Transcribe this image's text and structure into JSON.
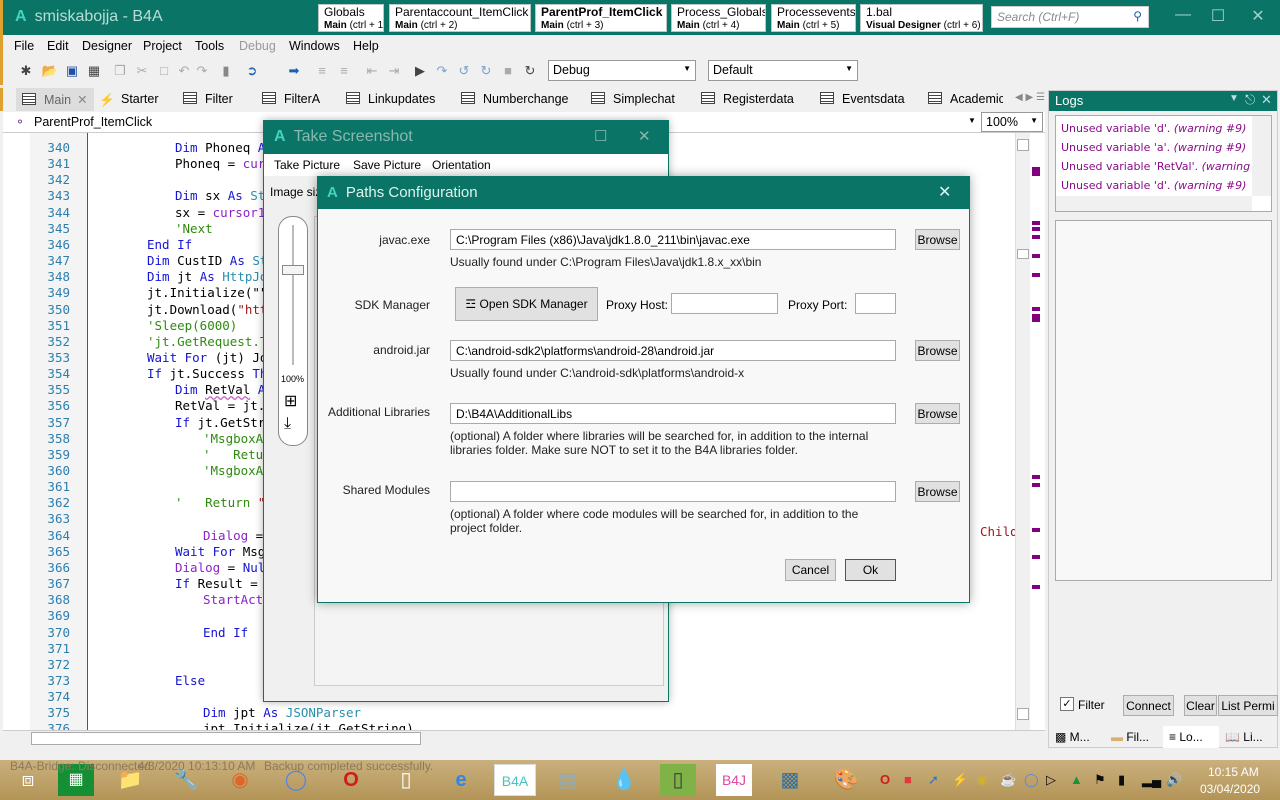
{
  "app": {
    "title": "smiskabojja - B4A",
    "logo": "A"
  },
  "quick_tabs": [
    {
      "name": "Globals",
      "module": "Main",
      "shortcut": "(ctrl + 1)"
    },
    {
      "name": "Parentaccount_ItemClick",
      "module": "Main",
      "shortcut": "(ctrl + 2)"
    },
    {
      "name": "ParentProf_ItemClick",
      "module": "Main",
      "shortcut": "(ctrl + 3)",
      "active": true
    },
    {
      "name": "Process_Globals",
      "module": "Main",
      "shortcut": "(ctrl + 4)"
    },
    {
      "name": "Processevents",
      "module": "Main",
      "shortcut": "(ctrl + 5)"
    },
    {
      "name": "1.bal",
      "module": "Visual Designer",
      "shortcut": "(ctrl + 6)"
    }
  ],
  "search": {
    "placeholder": "Search (Ctrl+F)"
  },
  "menu": [
    "File",
    "Edit",
    "Designer",
    "Project",
    "Tools",
    "Debug",
    "Windows",
    "Help"
  ],
  "toolbar": {
    "build_config": "Debug",
    "target": "Default"
  },
  "module_tabs": [
    "Main",
    "Starter",
    "Filter",
    "FilterA",
    "Linkupdates",
    "Numberchange",
    "Simplechat",
    "Registerdata",
    "Eventsdata",
    "Academic"
  ],
  "editor": {
    "sub": "ParentProf_ItemClick",
    "zoom": "100%",
    "lines": [
      {
        "n": 340,
        "i": 2,
        "t": [
          [
            "kw",
            "Dim"
          ],
          [
            "pl",
            " Phoneq "
          ],
          [
            "kw",
            "As"
          ]
        ]
      },
      {
        "n": 341,
        "i": 2,
        "t": [
          [
            "pl",
            "Phoneq = "
          ],
          [
            "pu",
            "curs"
          ]
        ]
      },
      {
        "n": 342,
        "i": 0,
        "t": []
      },
      {
        "n": 343,
        "i": 2,
        "t": [
          [
            "kw",
            "Dim"
          ],
          [
            "pl",
            " sx "
          ],
          [
            "kw",
            "As"
          ],
          [
            "ty",
            " Str"
          ]
        ]
      },
      {
        "n": 344,
        "i": 2,
        "t": [
          [
            "pl",
            "sx = "
          ],
          [
            "pu",
            "cursor1."
          ]
        ]
      },
      {
        "n": 345,
        "i": 2,
        "t": [
          [
            "cm",
            "'Next"
          ]
        ]
      },
      {
        "n": 346,
        "i": 1,
        "t": [
          [
            "kw",
            "End If"
          ]
        ]
      },
      {
        "n": 347,
        "i": 1,
        "t": [
          [
            "kw",
            "Dim"
          ],
          [
            "pl",
            " CustID "
          ],
          [
            "kw",
            "As"
          ],
          [
            "ty",
            " Str"
          ]
        ]
      },
      {
        "n": 348,
        "i": 1,
        "t": [
          [
            "kw",
            "Dim"
          ],
          [
            "pl",
            " jt "
          ],
          [
            "kw",
            "As"
          ],
          [
            "ty",
            " HttpJob"
          ]
        ]
      },
      {
        "n": 349,
        "i": 1,
        "t": [
          [
            "pl",
            "jt.Initialize(\"\","
          ]
        ]
      },
      {
        "n": 350,
        "i": 1,
        "t": [
          [
            "pl",
            "jt.Download("
          ],
          [
            "st",
            "\"http"
          ]
        ]
      },
      {
        "n": 351,
        "i": 1,
        "t": [
          [
            "cm",
            "'Sleep(6000)"
          ]
        ]
      },
      {
        "n": 352,
        "i": 1,
        "t": [
          [
            "cm",
            "'jt.GetRequest.Ti"
          ]
        ]
      },
      {
        "n": 353,
        "i": 1,
        "t": [
          [
            "kw",
            "Wait For"
          ],
          [
            "pl",
            " (jt) Job"
          ]
        ]
      },
      {
        "n": 354,
        "i": 1,
        "t": [
          [
            "kw",
            "If"
          ],
          [
            "pl",
            " jt.Success "
          ],
          [
            "kw",
            "The"
          ]
        ]
      },
      {
        "n": 355,
        "i": 2,
        "t": [
          [
            "kw",
            "Dim"
          ],
          [
            "pl",
            " "
          ],
          [
            "sq",
            "RetVal"
          ],
          [
            "pl",
            " "
          ],
          [
            "kw",
            "As"
          ]
        ]
      },
      {
        "n": 356,
        "i": 2,
        "t": [
          [
            "pl",
            "RetVal = jt.G"
          ]
        ]
      },
      {
        "n": 357,
        "i": 2,
        "t": [
          [
            "kw",
            "If"
          ],
          [
            "pl",
            " jt.GetStri"
          ]
        ]
      },
      {
        "n": 358,
        "i": 3,
        "t": [
          [
            "cm",
            "'MsgboxAs"
          ]
        ]
      },
      {
        "n": 359,
        "i": 3,
        "t": [
          [
            "cm",
            "'   Retur"
          ]
        ]
      },
      {
        "n": 360,
        "i": 3,
        "t": [
          [
            "cm",
            "'MsgboxAs"
          ]
        ]
      },
      {
        "n": 361,
        "i": 0,
        "t": []
      },
      {
        "n": 362,
        "i": 2,
        "t": [
          [
            "cm",
            "'   Return "
          ],
          [
            "st",
            "\"N"
          ]
        ]
      },
      {
        "n": 363,
        "i": 0,
        "t": []
      },
      {
        "n": 364,
        "i": 3,
        "t": [
          [
            "pu",
            "Dialog"
          ],
          [
            "pl",
            " ="
          ]
        ]
      },
      {
        "n": 365,
        "i": 2,
        "t": [
          [
            "kw",
            "Wait For"
          ],
          [
            "pl",
            " Msgb"
          ]
        ]
      },
      {
        "n": 366,
        "i": 2,
        "t": [
          [
            "pu",
            "Dialog"
          ],
          [
            "pl",
            " = "
          ],
          [
            "kw",
            "Null"
          ]
        ]
      },
      {
        "n": 367,
        "i": 2,
        "t": [
          [
            "kw",
            "If"
          ],
          [
            "pl",
            " Result = D"
          ]
        ]
      },
      {
        "n": 368,
        "i": 3,
        "t": [
          [
            "pu",
            "StartActi"
          ]
        ]
      },
      {
        "n": 369,
        "i": 0,
        "t": []
      },
      {
        "n": 370,
        "i": 3,
        "t": [
          [
            "kw",
            "End If"
          ]
        ]
      },
      {
        "n": 371,
        "i": 0,
        "t": []
      },
      {
        "n": 372,
        "i": 0,
        "t": []
      },
      {
        "n": 373,
        "i": 2,
        "t": [
          [
            "kw",
            "Else"
          ]
        ]
      },
      {
        "n": 374,
        "i": 0,
        "t": []
      },
      {
        "n": 375,
        "i": 3,
        "t": [
          [
            "kw",
            "Dim"
          ],
          [
            "pl",
            " jpt "
          ],
          [
            "kw",
            "As"
          ],
          [
            "ty",
            " JSONParser"
          ]
        ]
      },
      {
        "n": 376,
        "i": 3,
        "t": [
          [
            "pl",
            "jpt.Initialize(jt.GetString)"
          ]
        ]
      }
    ],
    "right_fragment": "Child"
  },
  "take_screenshot": {
    "title": "Take Screenshot",
    "menu": [
      "Take Picture",
      "Save Picture",
      "Orientation"
    ],
    "image_size_label": "Image siz",
    "zoom": "100%"
  },
  "paths": {
    "title": "Paths Configuration",
    "javac": {
      "label": "javac.exe",
      "value": "C:\\Program Files (x86)\\Java\\jdk1.8.0_211\\bin\\javac.exe",
      "hint": "Usually found under C:\\Program Files\\Java\\jdk1.8.x_xx\\bin"
    },
    "sdk": {
      "label": "SDK Manager",
      "button": "Open SDK Manager",
      "proxy_host_label": "Proxy Host:",
      "proxy_host": "",
      "proxy_port_label": "Proxy Port:",
      "proxy_port": ""
    },
    "android": {
      "label": "android.jar",
      "value": "C:\\android-sdk2\\platforms\\android-28\\android.jar",
      "hint": "Usually found under C:\\android-sdk\\platforms\\android-x"
    },
    "libs": {
      "label": "Additional Libraries",
      "value": "D:\\B4A\\AdditionalLibs",
      "hint1": "(optional) A folder where libraries will be searched for, in addition to the internal",
      "hint2": "libraries folder. Make sure NOT to set it to the B4A libraries folder."
    },
    "shared": {
      "label": "Shared Modules",
      "value": "",
      "hint1": "(optional) A folder where code modules will be searched for, in addition to the",
      "hint2": "project folder."
    },
    "browse": "Browse",
    "cancel": "Cancel",
    "ok": "Ok"
  },
  "logs": {
    "title": "Logs",
    "entries": [
      {
        "msg": "Unused variable 'd'.",
        "tag": "(warning #9)"
      },
      {
        "msg": "Unused variable 'a'.",
        "tag": "(warning #9)"
      },
      {
        "msg": "Unused variable 'RetVal'.",
        "tag": "(warning #9)"
      },
      {
        "msg": "Unused variable 'd'.",
        "tag": "(warning #9)"
      }
    ],
    "filter": "Filter",
    "filter_checked": true,
    "connect": "Connect",
    "clear": "Clear",
    "list_perm": "List Permi",
    "bottom_tabs": [
      "M...",
      "Fil...",
      "Lo...",
      "Li..."
    ]
  },
  "status": {
    "bridge": "B4A-Bridge: Disconnected",
    "time": "4/3/2020 10:13:10 AM",
    "message": "Backup completed successfully."
  },
  "taskbar": {
    "clock_time": "10:15 AM",
    "clock_date": "03/04/2020",
    "b4a": "B4A",
    "b4j": "B4J"
  },
  "colors": {
    "accent": "#0a7566",
    "warning": "#8a0a8a"
  }
}
